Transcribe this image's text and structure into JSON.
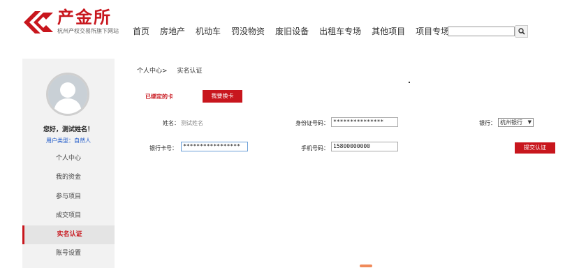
{
  "brand": {
    "title": "产金所",
    "subtitle": "杭州产权交易所旗下网站",
    "color": "#c8161d"
  },
  "nav": [
    "首页",
    "房地产",
    "机动车",
    "罚没物资",
    "废旧设备",
    "出租车专场",
    "其他项目",
    "项目专场"
  ],
  "search": {
    "value": "",
    "icon": "search-icon"
  },
  "sidebar": {
    "greeting": "您好，测试姓名！",
    "usertype": "用户类型：自然人",
    "menu": [
      "个人中心",
      "我的资金",
      "参与项目",
      "成交项目",
      "实名认证",
      "账号设置"
    ],
    "active_index": 4
  },
  "breadcrumb": [
    "个人中心>",
    "实名认证"
  ],
  "card": {
    "bound_label": "已绑定的卡",
    "change_button": "我要换卡"
  },
  "form": {
    "name_label": "姓名：",
    "name_value": "测试姓名",
    "id_label": "身份证号码：",
    "id_value": "***************",
    "bank_label": "银行：",
    "bank_value": "杭州银行",
    "card_label": "银行卡号：",
    "card_value": "*****************",
    "phone_label": "手机号码：",
    "phone_value": "15800000000",
    "submit_label": "提交认证"
  }
}
